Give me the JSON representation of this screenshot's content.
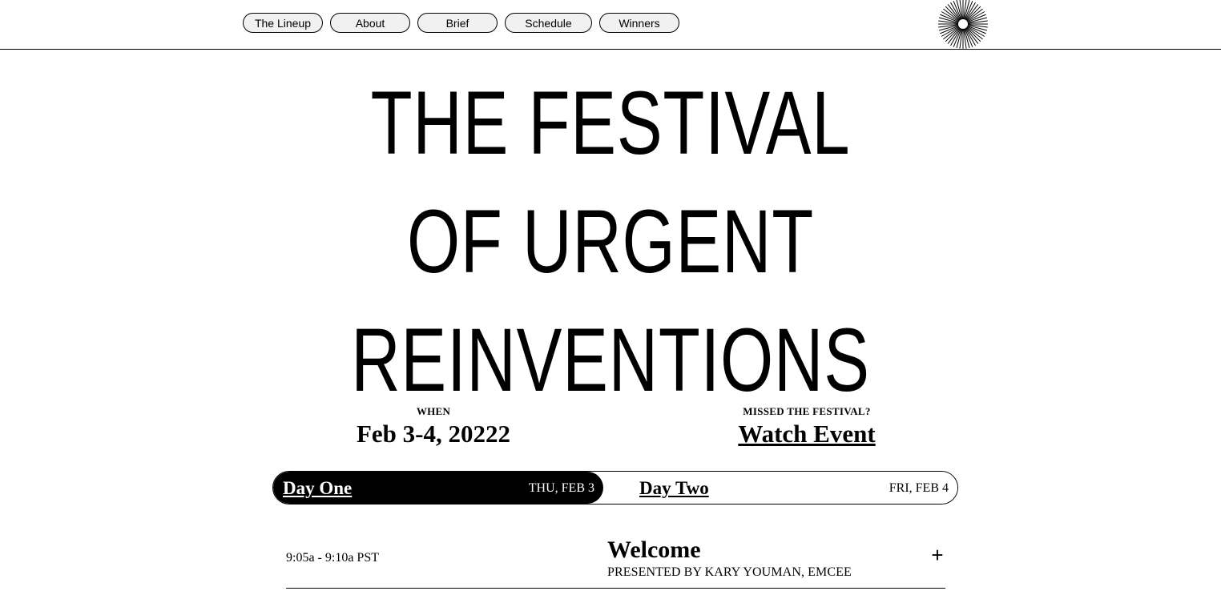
{
  "nav": {
    "items": [
      {
        "label": "The Lineup"
      },
      {
        "label": "About"
      },
      {
        "label": "Brief"
      },
      {
        "label": "Schedule"
      },
      {
        "label": "Winners"
      }
    ]
  },
  "logo": {
    "icon": "starburst-icon"
  },
  "hero": {
    "lines": [
      "THE FESTIVAL",
      "OF URGENT",
      "REINVENTIONS"
    ]
  },
  "info": {
    "when_label": "WHEN",
    "when_value": "Feb 3-4, 20222",
    "missed_label": "MISSED THE FESTIVAL?",
    "watch_link": "Watch Event"
  },
  "days": [
    {
      "name": "Day One",
      "date": "THU, FEB 3",
      "active": true
    },
    {
      "name": "Day Two",
      "date": "FRI, FEB 4",
      "active": false
    }
  ],
  "schedule": [
    {
      "time": "9:05a - 9:10a PST",
      "title": "Welcome",
      "presenter": "PRESENTED BY KARY YOUMAN, EMCEE",
      "expand_icon": "+"
    }
  ],
  "colors": {
    "background": "#ffffff",
    "foreground": "#000000",
    "pill": "#f1f1f1"
  }
}
